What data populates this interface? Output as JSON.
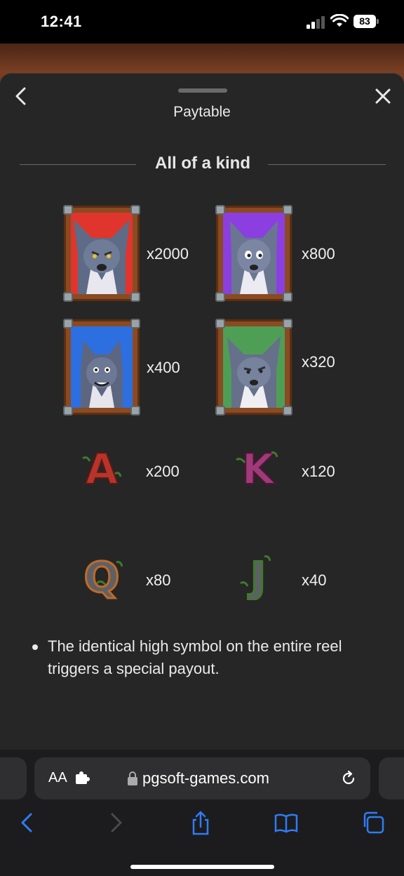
{
  "status_bar": {
    "time": "12:41",
    "battery": "83"
  },
  "panel": {
    "title": "Paytable",
    "section_title": "All of a kind"
  },
  "symbols": [
    {
      "name": "red wolf",
      "multiplier": "x2000",
      "bg": "#e0352c"
    },
    {
      "name": "purple wolf",
      "multiplier": "x800",
      "bg": "#8b3fe0"
    },
    {
      "name": "blue wolf",
      "multiplier": "x400",
      "bg": "#2d6fe0"
    },
    {
      "name": "green wolf",
      "multiplier": "x320",
      "bg": "#4f9e56"
    },
    {
      "name": "A",
      "multiplier": "x200",
      "color": "#b8342a"
    },
    {
      "name": "K",
      "multiplier": "x120",
      "color": "#a03a78"
    },
    {
      "name": "Q",
      "multiplier": "x80",
      "color": "#5d6166"
    },
    {
      "name": "J",
      "multiplier": "x40",
      "color": "#5d6166"
    }
  ],
  "note": "The identical high symbol on the entire reel triggers a special payout.",
  "browser": {
    "aa_label": "AA",
    "url": "pgsoft-games.com"
  }
}
